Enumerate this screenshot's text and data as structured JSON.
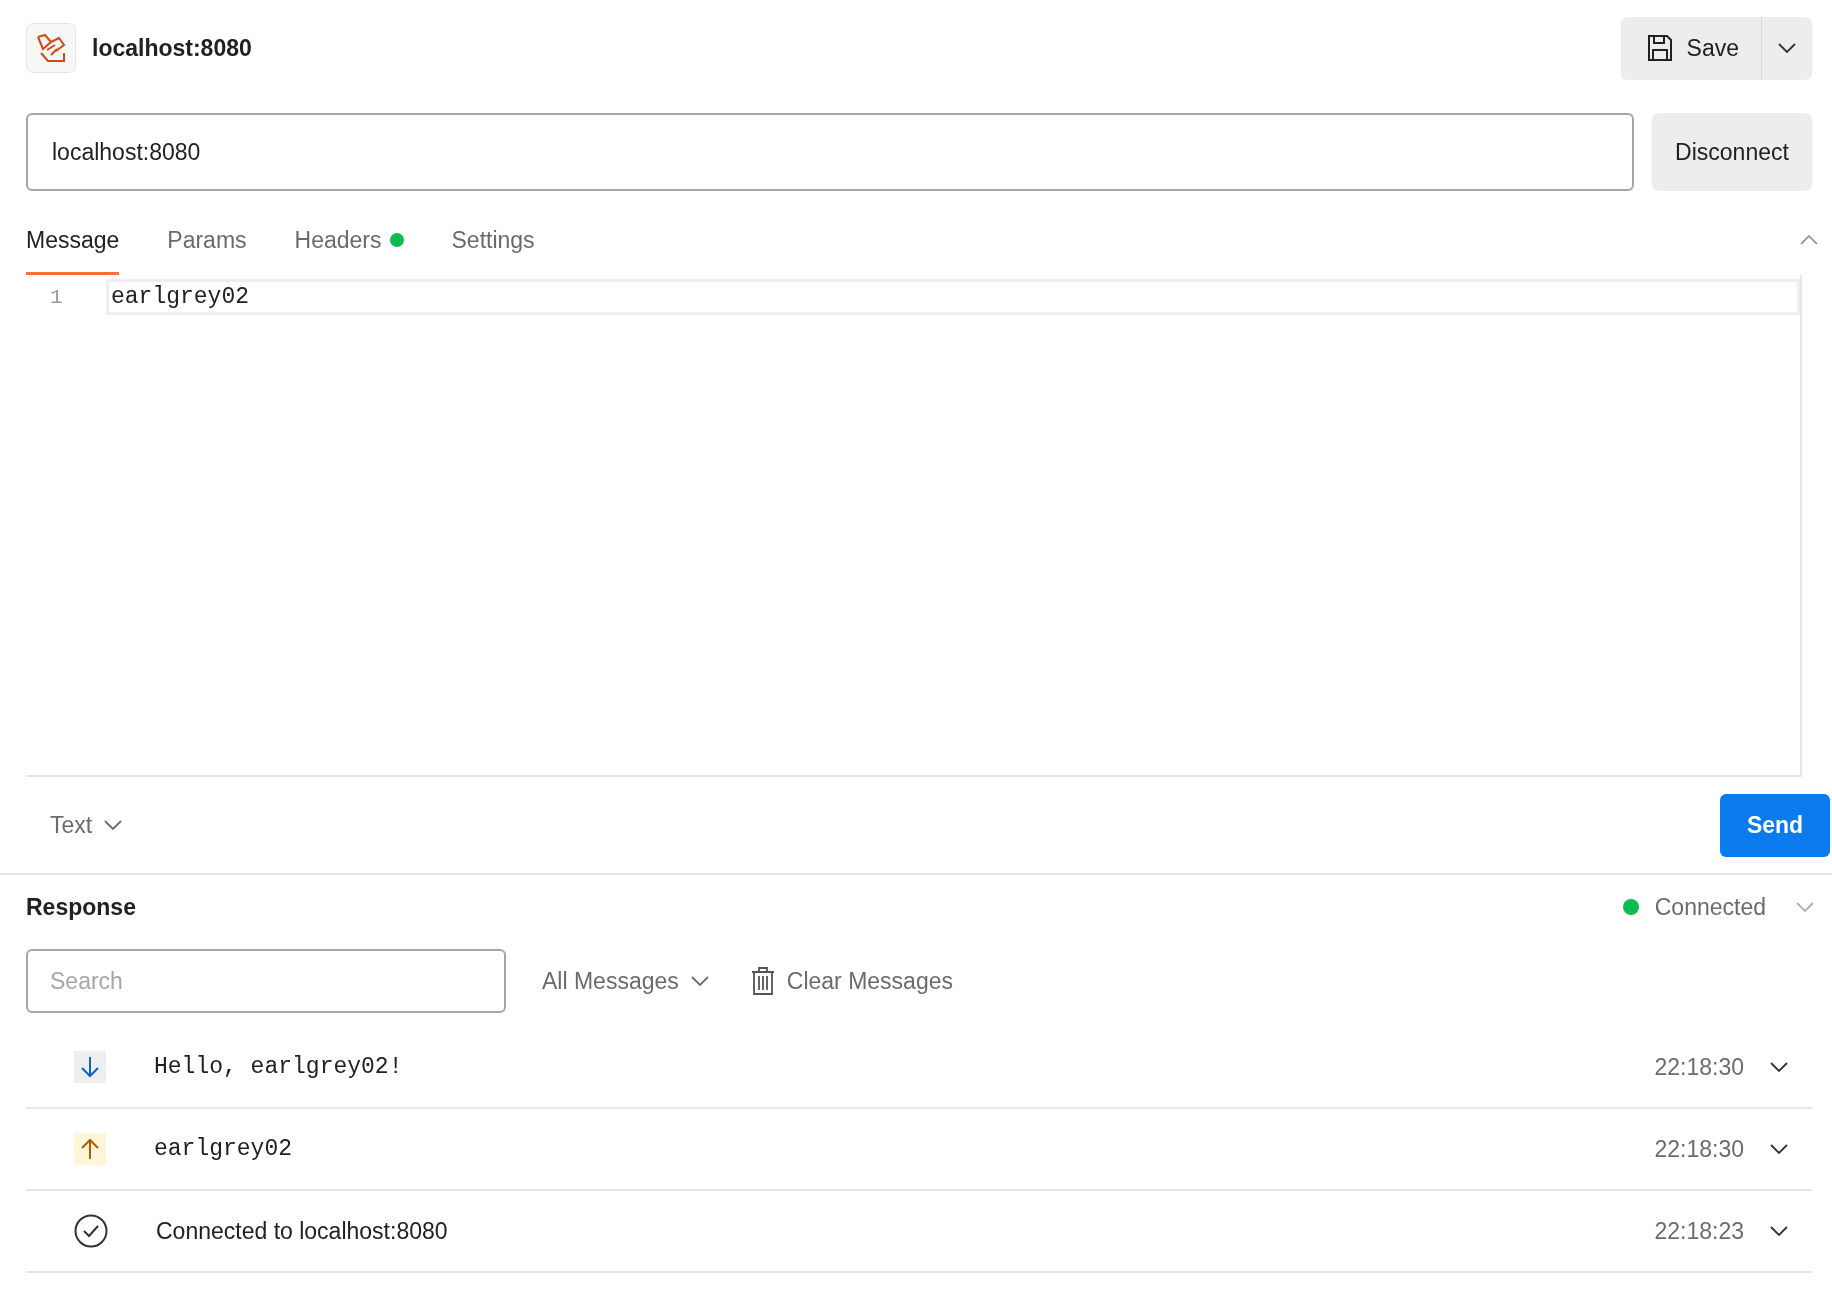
{
  "header": {
    "title": "localhost:8080",
    "save_label": "Save"
  },
  "connection": {
    "url": "localhost:8080",
    "action": "Disconnect"
  },
  "tabs": [
    {
      "label": "Message",
      "selected": true,
      "indicator": false
    },
    {
      "label": "Params",
      "selected": false,
      "indicator": false
    },
    {
      "label": "Headers",
      "selected": false,
      "indicator": true
    },
    {
      "label": "Settings",
      "selected": false,
      "indicator": false
    }
  ],
  "editor": {
    "lines": [
      {
        "number": "1",
        "text": "earlgrey02"
      }
    ]
  },
  "composer": {
    "format": "Text",
    "send_label": "Send"
  },
  "response": {
    "title": "Response",
    "status": "Connected",
    "connected": true,
    "search": {
      "placeholder": "Search"
    },
    "filter": "All Messages",
    "clear_label": "Clear Messages",
    "messages": [
      {
        "kind": "incoming",
        "text": "Hello, earlgrey02!",
        "time": "22:18:30"
      },
      {
        "kind": "outgoing",
        "text": "earlgrey02",
        "time": "22:18:30"
      },
      {
        "kind": "system",
        "text": "Connected to localhost:8080",
        "time": "22:18:23"
      }
    ]
  }
}
